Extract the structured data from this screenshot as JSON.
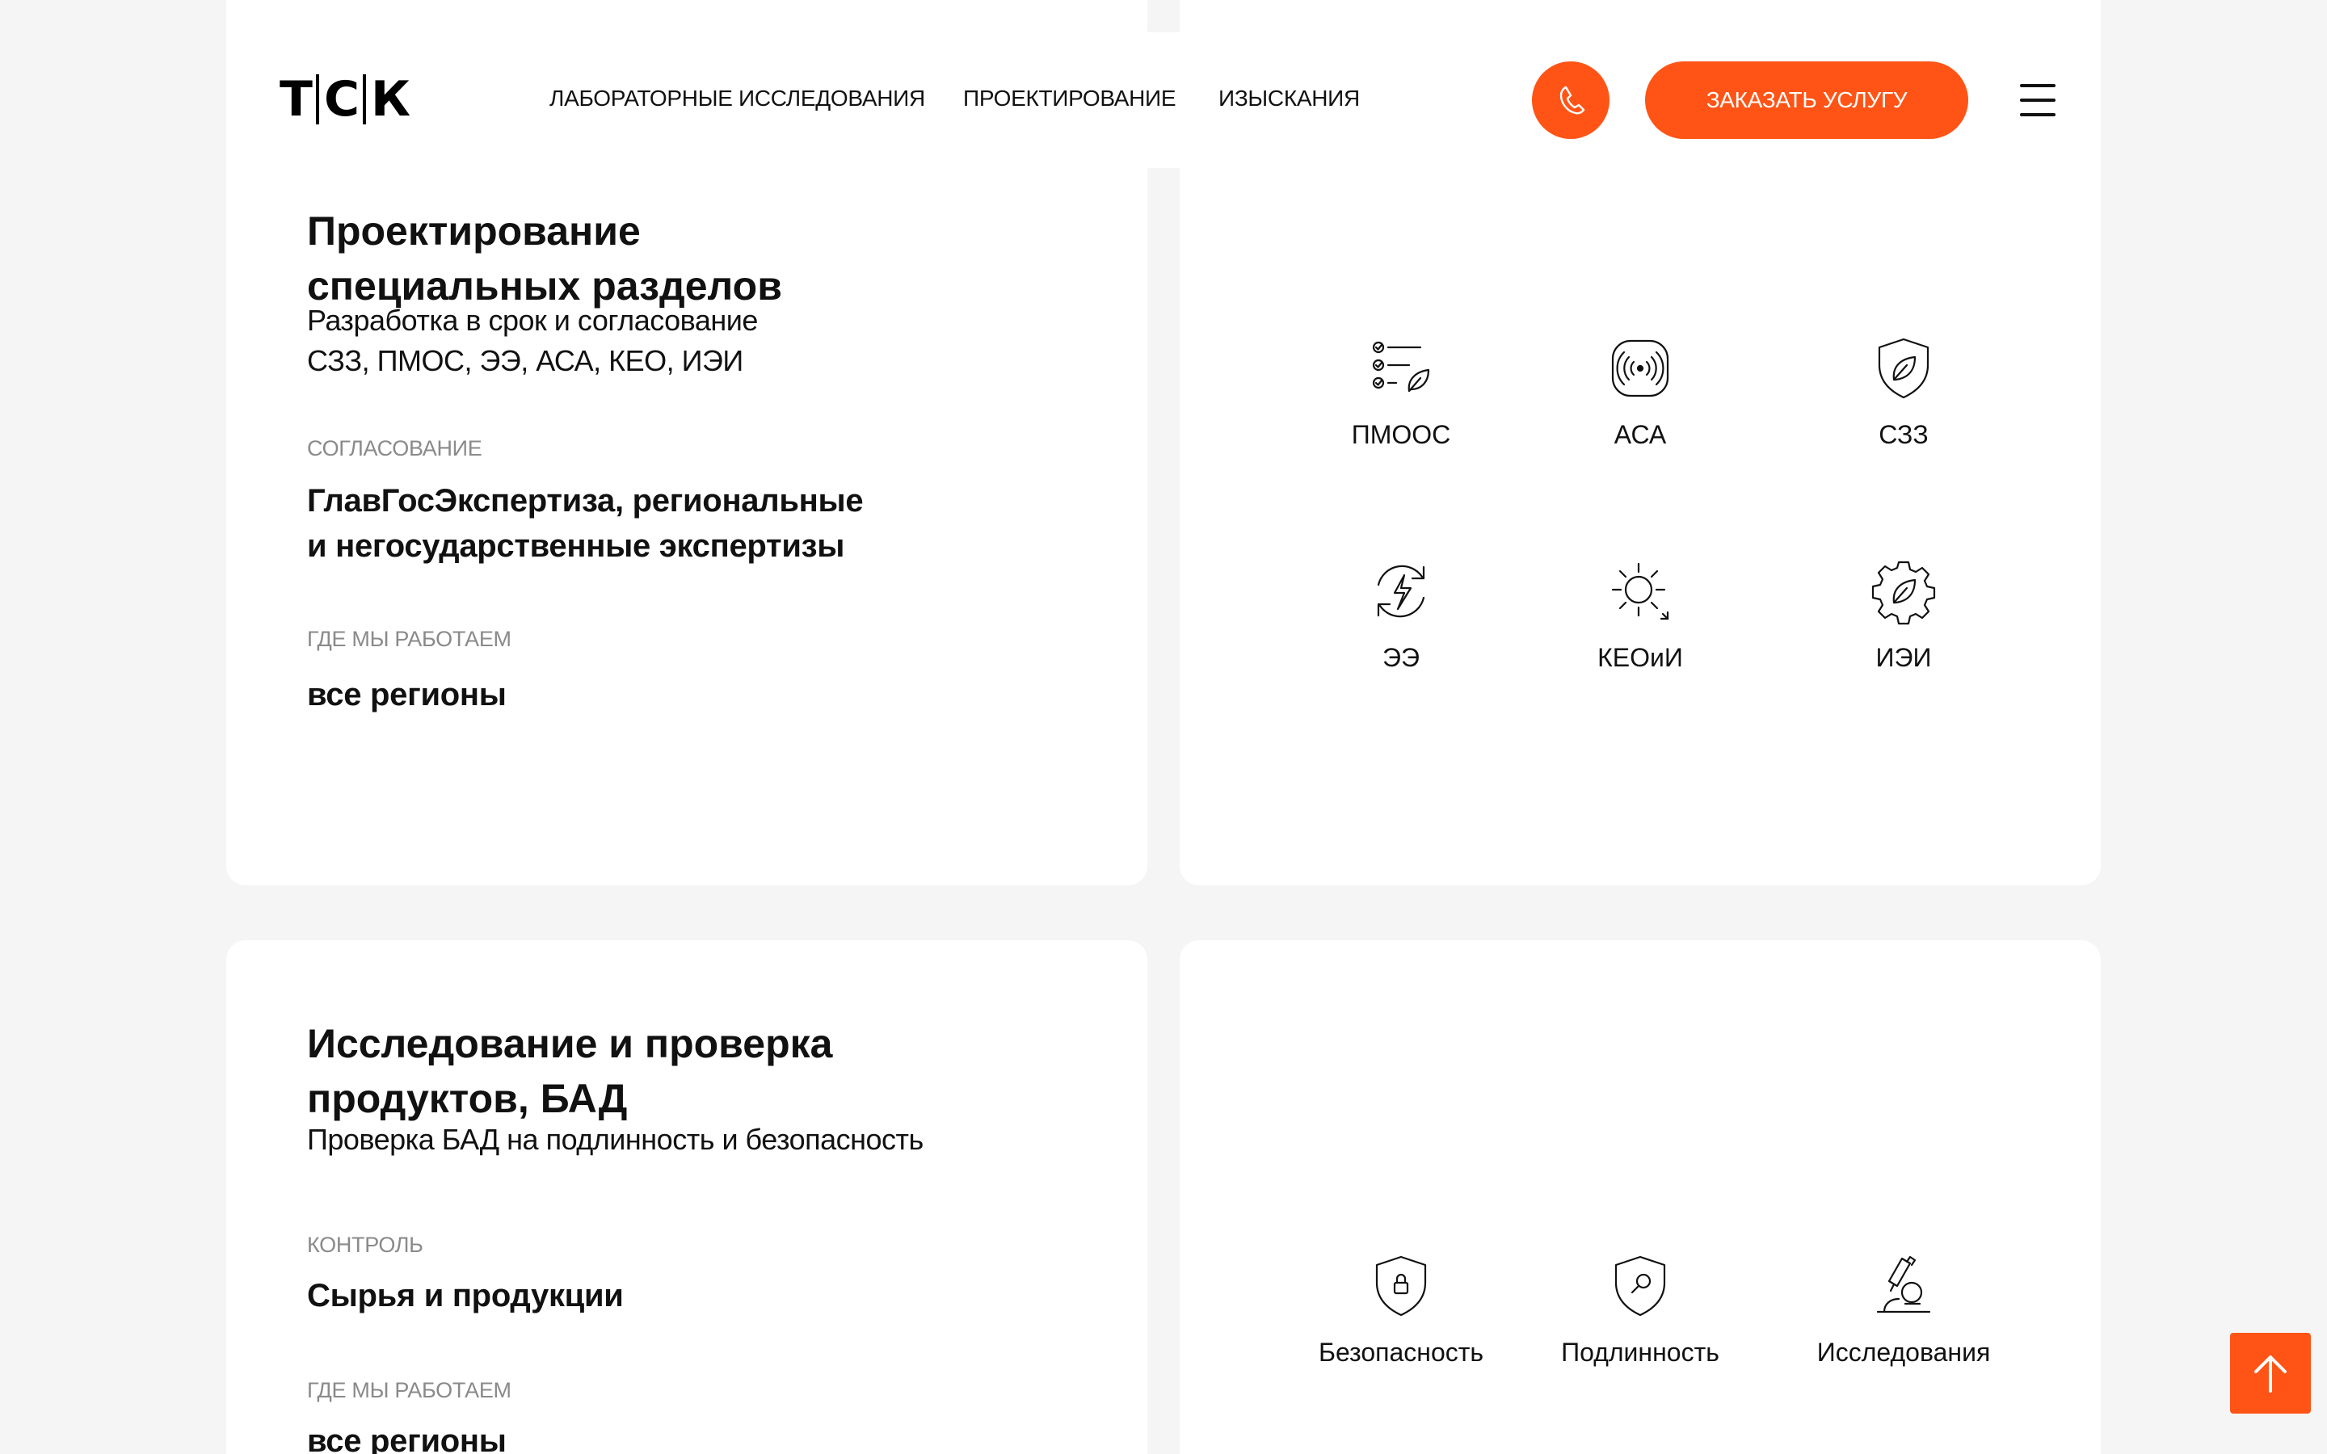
{
  "header": {
    "logo": {
      "left": "Т",
      "mid": "С",
      "right": "К"
    },
    "nav": [
      {
        "label": "ЛАБОРАТОРНЫЕ ИССЛЕДОВАНИЯ"
      },
      {
        "label": "ПРОЕКТИРОВАНИЕ"
      },
      {
        "label": "ИЗЫСКАНИЯ"
      }
    ],
    "phone_icon": "phone-icon",
    "order_label": "ЗАКАЗАТЬ УСЛУГУ",
    "menu_icon": "hamburger-icon"
  },
  "colors": {
    "accent": "#ff5416",
    "background": "#f5f5f5",
    "card": "#ffffff",
    "muted": "#8a8a8a"
  },
  "section1": {
    "title_line1": "Проектирование",
    "title_line2": "специальных разделов",
    "subtitle_line1": "Разработка в срок и согласование",
    "subtitle_line2": "СЗЗ, ПМОС, ЭЭ, АСА, КЕО, ИЭИ",
    "label1": "СОГЛАСОВАНИЕ",
    "value1_line1": "ГлавГосЭкспертиза, региональные",
    "value1_line2": "и негосударственные экспертизы",
    "label2": "ГДЕ МЫ РАБОТАЕМ",
    "value2": "все регионы",
    "icons": [
      {
        "label": "ПМООС",
        "icon": "checklist-leaf-icon"
      },
      {
        "label": "АСА",
        "icon": "sound-waves-icon"
      },
      {
        "label": "СЗЗ",
        "icon": "shield-leaf-icon"
      },
      {
        "label": "ЭЭ",
        "icon": "energy-cycle-icon"
      },
      {
        "label": "КЕОиИ",
        "icon": "sun-icon"
      },
      {
        "label": "ИЭИ",
        "icon": "gear-leaf-icon"
      }
    ]
  },
  "section2": {
    "title_line1": "Исследование и проверка",
    "title_line2": "продуктов, БАД",
    "subtitle": "Проверка БАД на подлинность и безопасность",
    "label1": "КОНТРОЛЬ",
    "value1": "Сырья и продукции",
    "label2": "ГДЕ МЫ РАБОТАЕМ",
    "value2": "все регионы",
    "icons": [
      {
        "label": "Безопасность",
        "icon": "shield-lock-icon"
      },
      {
        "label": "Подлинность",
        "icon": "shield-search-icon"
      },
      {
        "label": "Исследования",
        "icon": "microscope-icon"
      }
    ]
  },
  "scroll_top_icon": "arrow-up-icon"
}
